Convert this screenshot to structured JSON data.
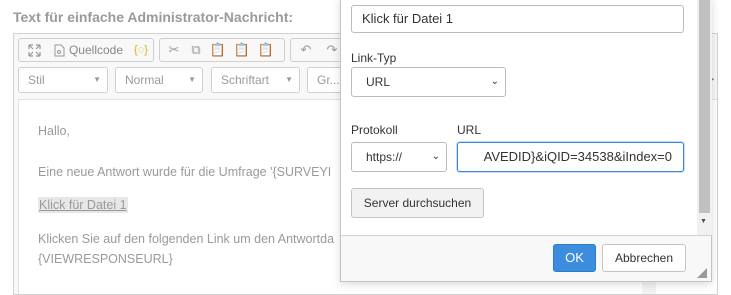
{
  "page": {
    "field_label": "Text für einfache Administrator-Nachricht:"
  },
  "toolbar": {
    "source_label": "Quellcode",
    "style_combo": "Stil",
    "format_combo": "Normal",
    "font_combo": "Schriftart",
    "size_combo": "Gr..."
  },
  "editor": {
    "line1": "Hallo,",
    "line2": "Eine neue Antwort wurde für die Umfrage '{SURVEYI",
    "link_text": "Klick für Datei 1",
    "line4": "Klicken Sie auf den folgenden Link um den Antwortda",
    "line5": "{VIEWRESPONSEURL}"
  },
  "dialog": {
    "display_text_value": "Klick für Datei 1",
    "link_type_label": "Link-Typ",
    "link_type_value": "URL",
    "protocol_label": "Protokoll",
    "protocol_value": "https://",
    "url_label": "URL",
    "url_value": "AVEDID}&iQID=34538&iIndex=0",
    "browse_server_label": "Server durchsuchen",
    "ok_label": "OK",
    "cancel_label": "Abbrechen"
  }
}
